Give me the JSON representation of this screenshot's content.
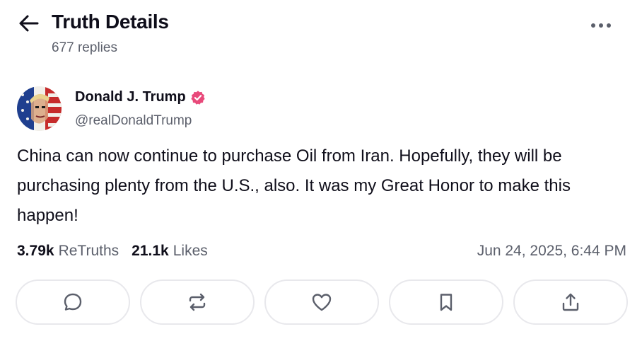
{
  "header": {
    "title": "Truth Details",
    "replies": "677 replies",
    "back_icon": "arrow-left-icon",
    "more_icon": "more-horizontal-icon"
  },
  "post": {
    "author_name": "Donald J. Trump",
    "author_handle": "@realDonaldTrump",
    "verified": true,
    "verified_color": "#e8497a",
    "text": "China can now continue to purchase Oil from Iran. Hopefully, they will be purchasing plenty from the U.S., also. It was my Great Honor to make this happen!",
    "retruths_count": "3.79k",
    "retruths_label": "ReTruths",
    "likes_count": "21.1k",
    "likes_label": "Likes",
    "timestamp": "Jun 24, 2025, 6:44 PM"
  },
  "actions": [
    {
      "name": "reply",
      "icon": "comment-icon"
    },
    {
      "name": "retruth",
      "icon": "repost-icon"
    },
    {
      "name": "like",
      "icon": "heart-icon"
    },
    {
      "name": "bookmark",
      "icon": "bookmark-icon"
    },
    {
      "name": "share",
      "icon": "share-icon"
    }
  ]
}
